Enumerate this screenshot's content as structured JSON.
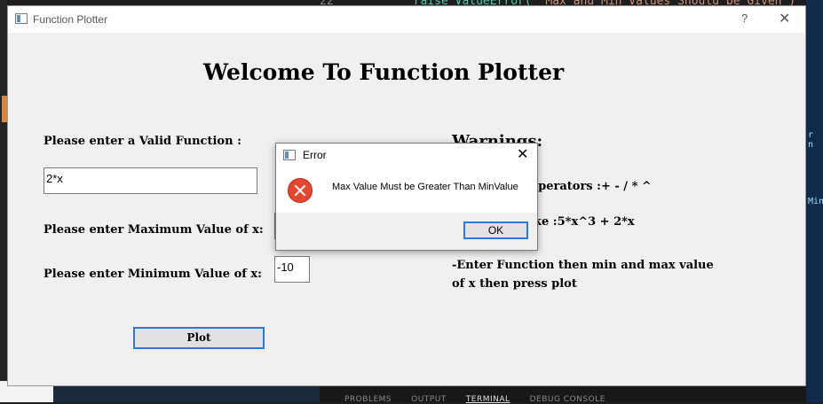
{
  "background": {
    "code_line_number": "22",
    "code_text": "raise ValueError(",
    "code_string": "\"Max and Min Values Should be Given\")",
    "right_panel_text_1": "r n",
    "right_panel_text_2": "Min",
    "panel_tabs": [
      "PROBLEMS",
      "OUTPUT",
      "TERMINAL",
      "DEBUG CONSOLE"
    ]
  },
  "window": {
    "title": "Function Plotter",
    "help_label": "?",
    "close_label": "✕"
  },
  "main": {
    "heading": "Welcome To Function Plotter",
    "function_label": "Please enter a Valid Function :",
    "function_value": "2*x",
    "max_label": "Please enter Maximum Value of x:",
    "max_value": "",
    "min_label": "Please enter Minimum Value of x:",
    "min_value": "-10",
    "plot_label": "Plot"
  },
  "warnings": {
    "title": "Warnings:",
    "line1": "-Supported Operators :+ - / * ^",
    "line2": "-Functions like :5*x^3 + 2*x",
    "line3": "-Enter Function then min and max value",
    "line4": "of x then press plot"
  },
  "dialog": {
    "title": "Error",
    "close_label": "✕",
    "message": "Max Value Must be Greater Than MinValue",
    "ok_label": "OK"
  }
}
